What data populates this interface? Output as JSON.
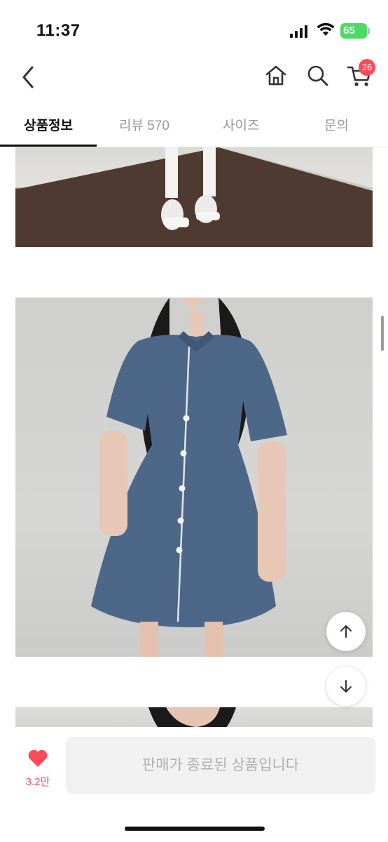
{
  "status_bar": {
    "time": "11:37",
    "battery": "65"
  },
  "nav": {
    "cart_badge": "26"
  },
  "tabs": [
    {
      "label": "상품정보",
      "active": true
    },
    {
      "label": "리뷰 570",
      "active": false
    },
    {
      "label": "사이즈",
      "active": false
    },
    {
      "label": "문의",
      "active": false
    }
  ],
  "bottom": {
    "like_count": "3.2만",
    "sold_out_label": "판매가 종료된 상품입니다"
  },
  "colors": {
    "accent": "#ff4a5a",
    "battery": "#4cd964",
    "denim": "#4d6789"
  }
}
